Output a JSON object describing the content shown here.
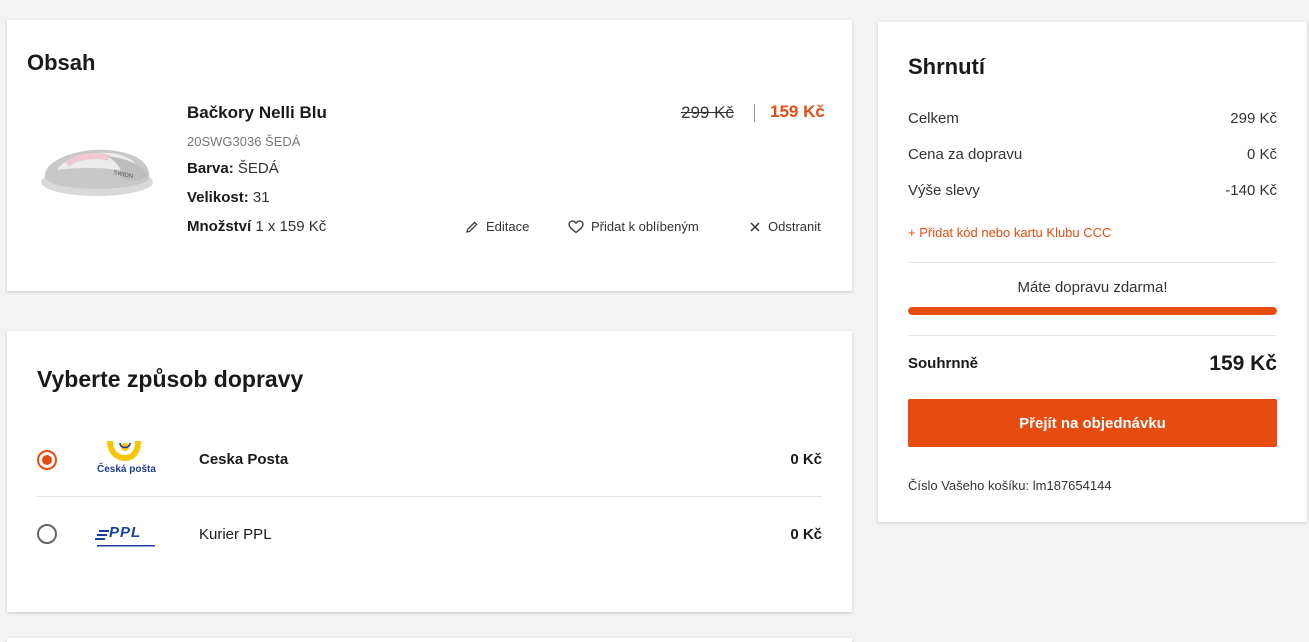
{
  "cart": {
    "title": "Obsah",
    "product": {
      "name": "Bačkory Nelli Blu",
      "sku": "20SWG3036 ŠEDÁ",
      "color_label": "Barva:",
      "color_value": "ŠEDÁ",
      "size_label": "Velikost:",
      "size_value": "31",
      "qty_label": "Množství",
      "qty_value": "1 x 159 Kč",
      "old_price": "299 Kč",
      "new_price": "159 Kč"
    },
    "actions": {
      "edit": "Editace",
      "favorite": "Přidat k oblíbeným",
      "remove": "Odstranit"
    }
  },
  "shipping": {
    "title": "Vyberte způsob dopravy",
    "options": [
      {
        "name": "Ceska Posta",
        "price": "0 Kč",
        "selected": true,
        "logo_text": "Česká pošta"
      },
      {
        "name": "Kurier PPL",
        "price": "0 Kč",
        "selected": false,
        "logo_text": "PPL"
      }
    ]
  },
  "summary": {
    "title": "Shrnutí",
    "rows": [
      {
        "label": "Celkem",
        "value": "299 Kč"
      },
      {
        "label": "Cena za dopravu",
        "value": "0 Kč"
      },
      {
        "label": "Výše slevy",
        "value": "-140 Kč"
      }
    ],
    "promo_link": "+ Přidat kód nebo kartu Klubu CCC",
    "free_shipping_msg": "Máte dopravu zdarma!",
    "free_shipping_progress": 1.0,
    "final_label": "Souhrnně",
    "final_value": "159 Kč",
    "checkout_label": "Přejít na objednávku",
    "basket_id": "Číslo Vašeho košíku: lm187654144"
  },
  "colors": {
    "accent": "#e64b10",
    "posta_yellow": "#f7c600",
    "posta_blue": "#1f3d8c",
    "ppl_blue": "#1a3f9c"
  }
}
